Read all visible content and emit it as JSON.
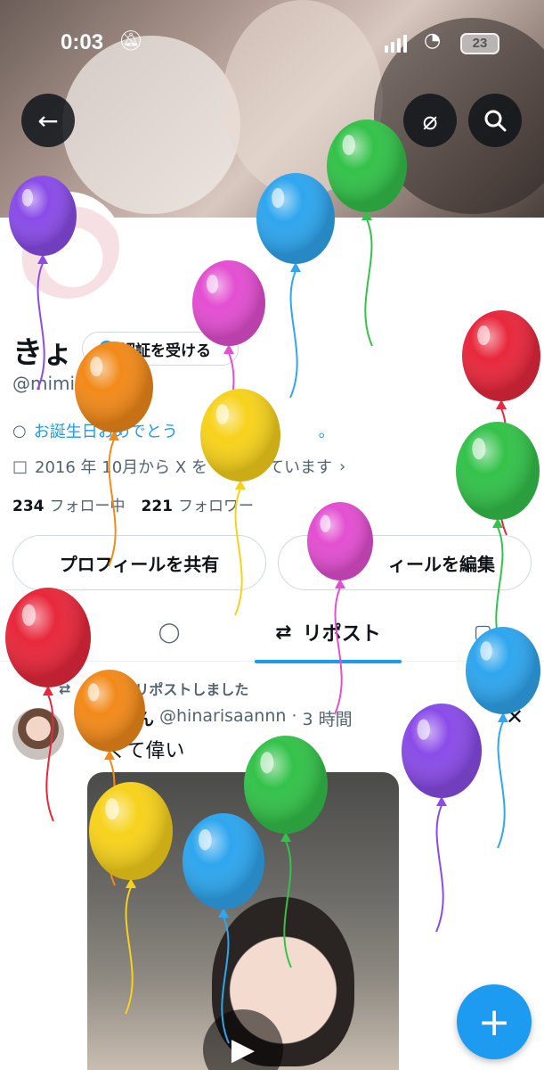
{
  "status_bar": {
    "time": "0:03",
    "battery": "23"
  },
  "icons": {
    "back": "arrow-left-icon",
    "grok": "grok-icon",
    "search": "search-icon",
    "mute": "bell-slash-icon",
    "signal": "signal-icon",
    "wifi": "wifi-icon",
    "location": "location-pin-icon",
    "calendar": "calendar-icon",
    "chevron": "chevron-right-icon",
    "reply": "speech-bubble-icon",
    "repost": "repost-icon",
    "media": "media-icon",
    "play": "play-icon",
    "plus": "plus-icon",
    "x": "x-logo-icon"
  },
  "profile": {
    "name": "きょ",
    "verify_label": "認証を受ける",
    "handle": "@mimi",
    "bio": "お誕生日おめでとう",
    "bio_end": "。",
    "joined_prefix": "2016 年 10月から X を",
    "joined_suffix": "ています",
    "following_count": "234",
    "following_label": "フォロー中",
    "followers_count": "221",
    "followers_label": "フォロワー"
  },
  "actions": {
    "share_profile": "プロフィールを共有",
    "edit_profile": "ィールを編集"
  },
  "tabs": {
    "reposts": "リポスト"
  },
  "post": {
    "repost_note": "がリポストしました",
    "author_name": "ん",
    "author_handle": "@hinarisaannn",
    "separator": "·",
    "time": "3 時間",
    "text": "くて偉い"
  },
  "colors": {
    "accent": "#1d9bf0",
    "text": "#0f1419",
    "muted": "#536471",
    "border": "#cfd9de",
    "balloon_red": "#e8283c",
    "balloon_orange": "#f28a1a",
    "balloon_yellow": "#f7d21c",
    "balloon_green": "#34c24a",
    "balloon_blue": "#2fa6ee",
    "balloon_purple": "#8a4ce8",
    "balloon_pink": "#e34fd1"
  }
}
